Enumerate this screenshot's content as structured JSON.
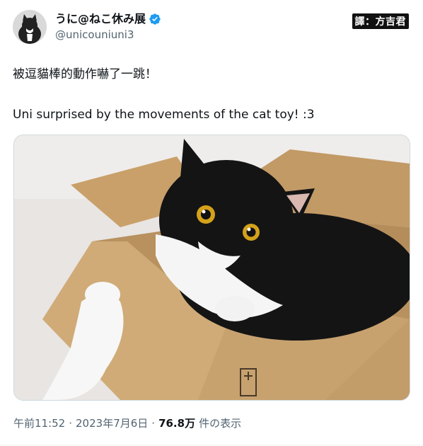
{
  "author": {
    "display_name": "うに@ねこ休み展",
    "handle": "@unicouniuni3",
    "verified": true
  },
  "translator_credit": "譯：方吉君",
  "tweet": {
    "text_chinese": "被逗貓棒的動作嚇了一跳！",
    "text_english": "Uni surprised by the movements of the cat toy! :3"
  },
  "media": {
    "subject": "black-and-white tuxedo cat in a cardboard box"
  },
  "meta": {
    "time": "午前11:52",
    "separator": "·",
    "date": "2023年7月6日",
    "views_count": "76.8万",
    "views_label": "件の表示"
  },
  "colors": {
    "verified_blue": "#1d9bf0",
    "secondary_text": "#536471",
    "primary_text": "#0f1419"
  }
}
